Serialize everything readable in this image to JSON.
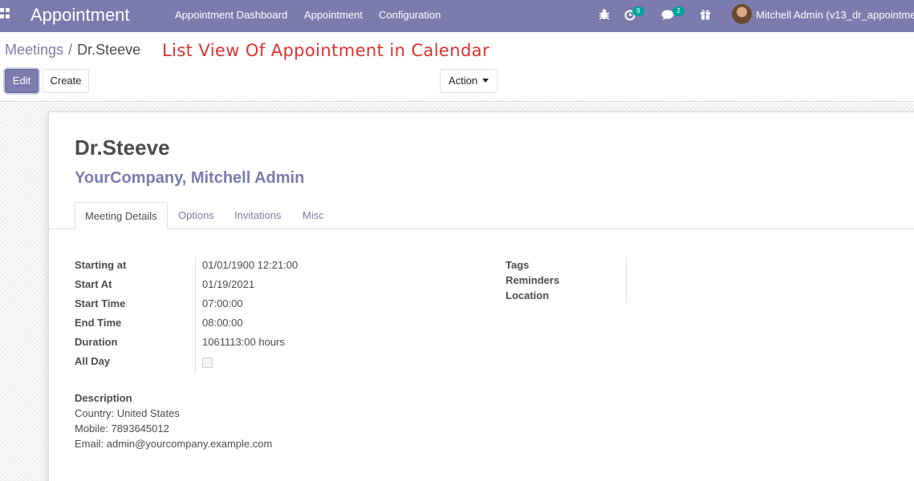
{
  "navbar": {
    "app_name": "Appointment",
    "menu": [
      "Appointment Dashboard",
      "Appointment",
      "Configuration"
    ],
    "activity_count": "9",
    "messages_count": "2",
    "user_label": "Mitchell Admin (v13_dr_appointme",
    "icons": [
      "apps-grid-icon",
      "bug-icon",
      "clock-activity-icon",
      "chat-icon",
      "gift-icon"
    ]
  },
  "breadcrumb": {
    "parent": "Meetings",
    "separator": "/",
    "current": "Dr.Steeve"
  },
  "annotation": "List View Of Appointment in Calendar",
  "buttons": {
    "edit": "Edit",
    "create": "Create",
    "action": "Action"
  },
  "record": {
    "title": "Dr.Steeve",
    "attendees": "YourCompany, Mitchell Admin"
  },
  "tabs": [
    "Meeting Details",
    "Options",
    "Invitations",
    "Misc"
  ],
  "fields": [
    {
      "label": "Starting at",
      "value": "01/01/1900 12:21:00"
    },
    {
      "label": "Start At",
      "value": "01/19/2021"
    },
    {
      "label": "Start Time",
      "value": "07:00:00"
    },
    {
      "label": "End Time",
      "value": "08:00:00"
    },
    {
      "label": "Duration",
      "value": "1061113:00 hours"
    },
    {
      "label": "All Day",
      "value": ""
    }
  ],
  "right_fields": [
    "Tags",
    "Reminders",
    "Location"
  ],
  "description": {
    "label": "Description",
    "lines": [
      "Country: United States",
      "Mobile: 7893645012",
      "Email: admin@yourcompany.example.com"
    ]
  },
  "colors": {
    "brand": "#7c7bad",
    "badge": "#00a09d",
    "annotation": "#e03131"
  }
}
